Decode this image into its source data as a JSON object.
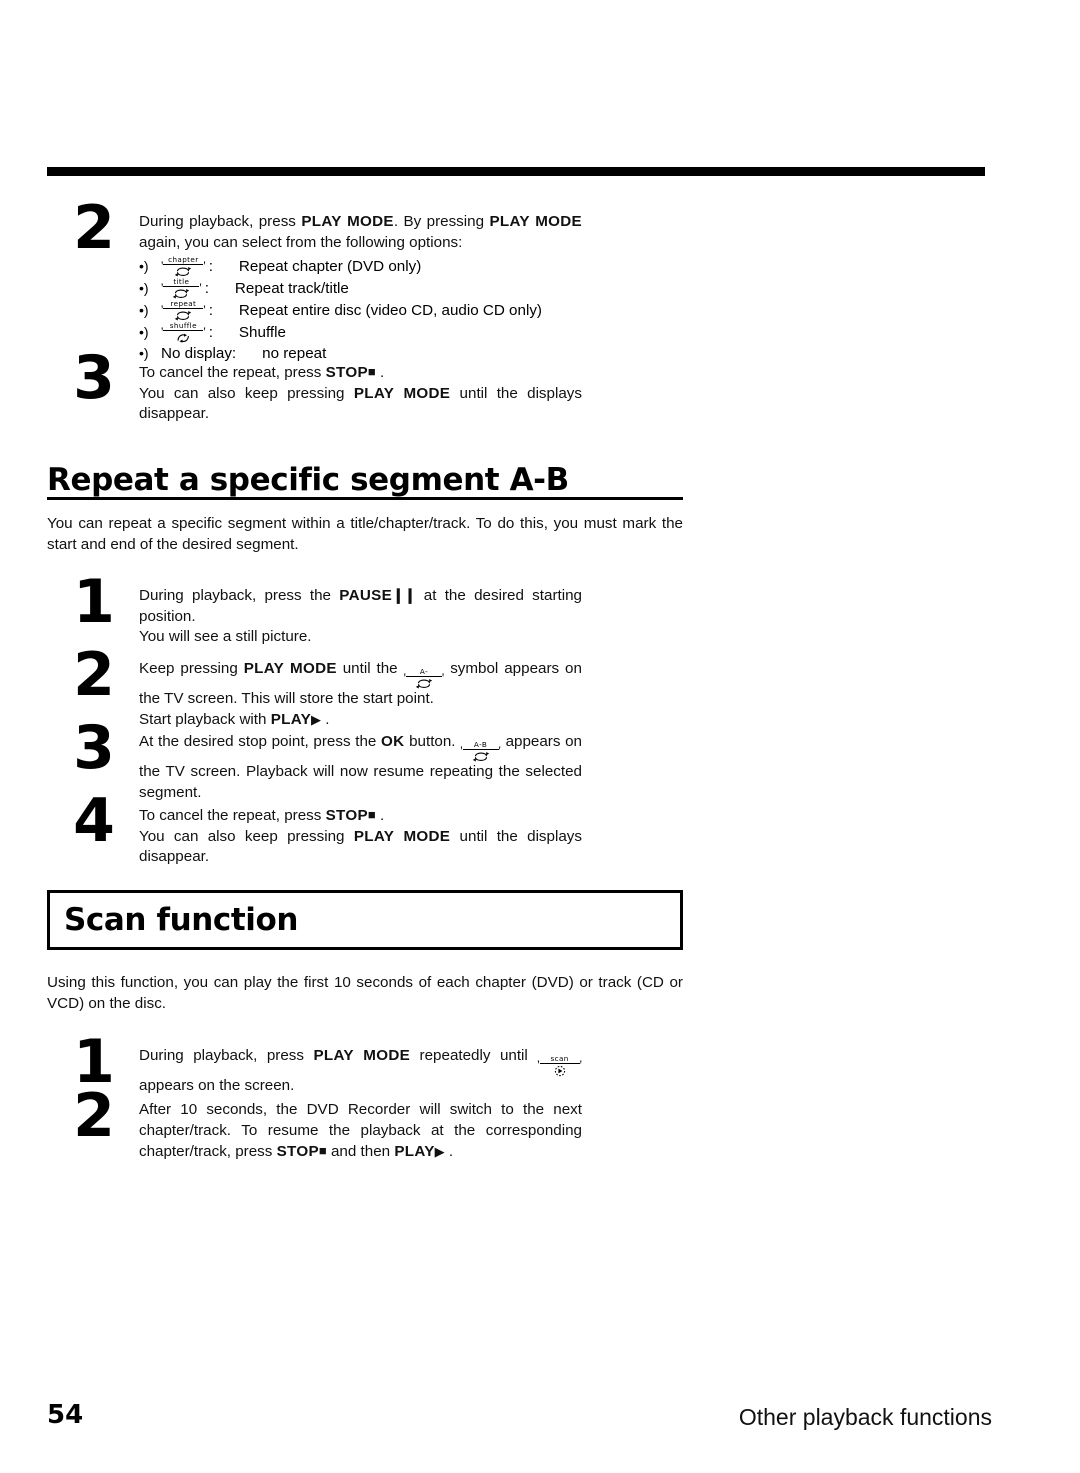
{
  "page": {
    "number": "54",
    "footer_title": "Other playback functions"
  },
  "steps_repeat": [
    {
      "number": "2",
      "line1_a": "During playback, press",
      "line1_kbd": "PLAY MODE",
      "line1_b": ". By pressing",
      "line1_kbd2": "PLAY MODE",
      "line1_c": "again, you can select from the following options:",
      "options": [
        {
          "bullet": "•)",
          "symbol_label": "chapter",
          "symbol_icon": "repeat-arrow-icon",
          "colon": ":",
          "text": "Repeat chapter (DVD only)"
        },
        {
          "bullet": "•)",
          "symbol_label": "title",
          "symbol_icon": "repeat-arrow-icon",
          "colon": ":",
          "text": "Repeat track/title"
        },
        {
          "bullet": "•)",
          "symbol_label": "repeat",
          "symbol_icon": "repeat-arrow-icon",
          "colon": ":",
          "text": "Repeat entire disc (video CD, audio CD only)"
        },
        {
          "bullet": "•)",
          "symbol_label": "shuffle",
          "symbol_icon": "shuffle-arrow-icon",
          "colon": ":",
          "text": "Shuffle"
        }
      ],
      "no_display_bullet": "•)",
      "no_display_label": "No display:",
      "no_display_text": "no repeat"
    },
    {
      "number": "3",
      "l1_a": "To cancel the repeat, press",
      "l1_kbd": "STOP",
      "l1_glyph": "■",
      "l1_b": ".",
      "l2_a": "You can also keep pressing",
      "l2_kbd": "PLAY MODE",
      "l2_b": "until the displays disappear."
    }
  ],
  "section_ab": {
    "heading": "Repeat a specific segment A-B",
    "intro": "You can repeat a specific segment within a title/chapter/track. To do this, you must mark the start and end of the desired segment.",
    "steps": [
      {
        "number": "1",
        "l1_a": "During playback, press the",
        "l1_kbd": "PAUSE",
        "l1_glyph": "❙❙",
        "l1_b": "at the desired starting position.",
        "l2": "You will see a still picture."
      },
      {
        "number": "2",
        "l1_a": "Keep pressing",
        "l1_kbd": "PLAY MODE",
        "l1_b": "until the",
        "symbol_label": "A-",
        "symbol_icon": "repeat-arrow-icon",
        "l1_c": "symbol appears on the TV screen. This will store the start point.",
        "l2_a": "Start playback with",
        "l2_kbd": "PLAY",
        "l2_glyph": "▶",
        "l2_b": "."
      },
      {
        "number": "3",
        "l1_a": "At the desired stop point, press the",
        "l1_kbd": "OK",
        "l1_b": "button.",
        "symbol_label": "A-B",
        "symbol_icon": "repeat-arrow-icon",
        "l1_c": "appears on the TV screen. Playback will now resume repeating the selected segment."
      },
      {
        "number": "4",
        "l1_a": "To cancel the repeat, press",
        "l1_kbd": "STOP",
        "l1_glyph": "■",
        "l1_b": ".",
        "l2_a": "You can also keep pressing",
        "l2_kbd": "PLAY MODE",
        "l2_b": "until the displays disappear."
      }
    ]
  },
  "section_scan": {
    "heading": "Scan function",
    "intro": "Using this function, you can play the first 10 seconds of each chapter (DVD) or track (CD or VCD) on the disc.",
    "steps": [
      {
        "number": "1",
        "l1_a": "During playback, press",
        "l1_kbd": "PLAY MODE",
        "l1_b": "repeatedly until",
        "symbol_label": "scan",
        "symbol_icon": "scan-play-icon",
        "l1_c": "appears on the screen."
      },
      {
        "number": "2",
        "l1": "After 10 seconds, the DVD Recorder will switch to the next chapter/track. To resume the playback at the corresponding chapter/track, press",
        "l2_kbd1": "STOP",
        "l2_glyph1": "■",
        "l2_mid": "and then",
        "l2_kbd2": "PLAY",
        "l2_glyph2": "▶",
        "l2_end": "."
      }
    ]
  },
  "colors": {
    "ink": "#000000",
    "paper": "#ffffff"
  }
}
